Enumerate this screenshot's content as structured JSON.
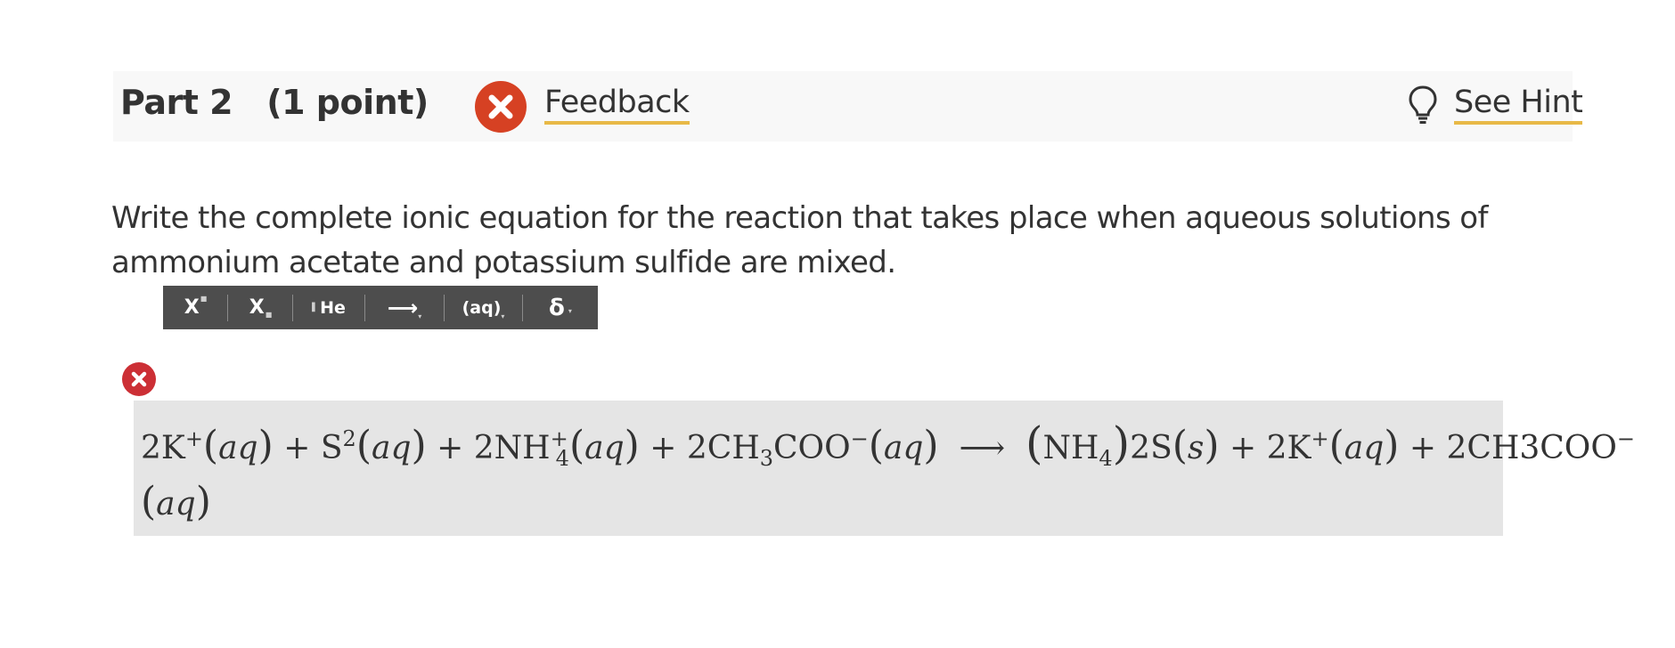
{
  "header": {
    "title": "Part 2",
    "points": "(1 point)",
    "feedback_label": "Feedback",
    "hint_label": "See Hint"
  },
  "question": {
    "text": "Write the complete ionic equation for the reaction that takes place when aqueous solutions of ammonium acetate and potassium sulfide are mixed."
  },
  "toolbar": {
    "superscript": "X",
    "subscript": "X",
    "element": "He",
    "arrow": "⟶",
    "aq": "(aq)",
    "delta": "δ",
    "dropdown_marker": "▾"
  },
  "answer": {
    "status": "incorrect",
    "status_color": "#cc2f35",
    "equation_text": "2K+(aq) + S2(aq) + 2NH4+(aq) + 2CH3COO−(aq) ⟶ (NH4)2S(s) + 2K+(aq) + 2CH3COO− (aq)",
    "terms": {
      "k_coef": "2K",
      "plus_sign": "+",
      "minus_sign": "−",
      "aq": "aq",
      "s_state": "s",
      "sulfide": "S",
      "two": "2",
      "nh_coef": "2NH",
      "four": "4",
      "acetate_coef": "2CH",
      "three": "3",
      "coo": "COO",
      "arrow": "⟶",
      "nh": "NH",
      "product_rest": "2S",
      "acetate_product": "2CH3COO"
    }
  }
}
